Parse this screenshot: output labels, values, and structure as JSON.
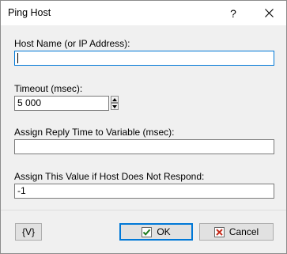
{
  "window": {
    "title": "Ping Host",
    "help_glyph": "?",
    "close_glyph": "✕"
  },
  "fields": {
    "host": {
      "label": "Host Name (or IP Address):",
      "value": ""
    },
    "timeout": {
      "label": "Timeout (msec):",
      "value": "5 000"
    },
    "reply_var": {
      "label": "Assign Reply Time to Variable (msec):",
      "value": ""
    },
    "no_response": {
      "label": "Assign This Value if Host Does Not Respond:",
      "value": "-1"
    }
  },
  "buttons": {
    "variable": "{V}",
    "ok": "OK",
    "cancel": "Cancel"
  },
  "colors": {
    "ok_check": "#1e7b1e",
    "cancel_x": "#c42b1c",
    "focus_border": "#0078d7"
  },
  "icons": {
    "help": "question-mark-icon",
    "close": "close-icon",
    "ok": "checkmark-icon",
    "cancel": "cross-icon",
    "spin_up": "arrow-up-icon",
    "spin_down": "arrow-down-icon"
  }
}
